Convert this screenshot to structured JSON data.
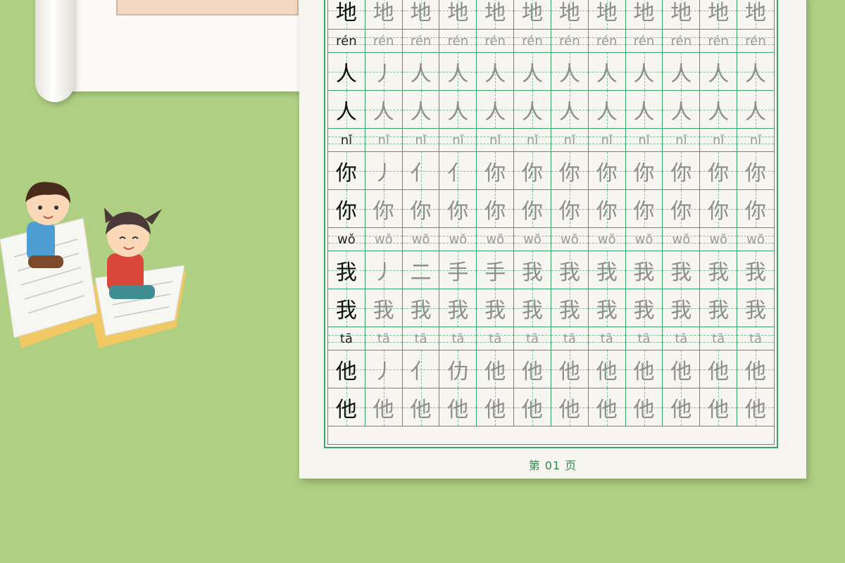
{
  "worksheet": {
    "page_label": "第 01 页",
    "columns": 12,
    "rows": [
      {
        "type": "hanzi",
        "cells": [
          "地",
          "地",
          "地",
          "地",
          "地",
          "地",
          "地",
          "地",
          "地",
          "地",
          "地",
          "地"
        ]
      },
      {
        "type": "pinyin",
        "cells": [
          "rén",
          "rén",
          "rén",
          "rén",
          "rén",
          "rén",
          "rén",
          "rén",
          "rén",
          "rén",
          "rén",
          "rén"
        ]
      },
      {
        "type": "hanzi",
        "cells": [
          "人",
          "丿",
          "人",
          "人",
          "人",
          "人",
          "人",
          "人",
          "人",
          "人",
          "人",
          "人"
        ]
      },
      {
        "type": "hanzi",
        "cells": [
          "人",
          "人",
          "人",
          "人",
          "人",
          "人",
          "人",
          "人",
          "人",
          "人",
          "人",
          "人"
        ]
      },
      {
        "type": "pinyin",
        "cells": [
          "nǐ",
          "nǐ",
          "nǐ",
          "nǐ",
          "nǐ",
          "nǐ",
          "nǐ",
          "nǐ",
          "nǐ",
          "nǐ",
          "nǐ",
          "nǐ"
        ]
      },
      {
        "type": "hanzi",
        "cells": [
          "你",
          "丿",
          "亻",
          "亻",
          "你",
          "你",
          "你",
          "你",
          "你",
          "你",
          "你",
          "你"
        ]
      },
      {
        "type": "hanzi",
        "cells": [
          "你",
          "你",
          "你",
          "你",
          "你",
          "你",
          "你",
          "你",
          "你",
          "你",
          "你",
          "你"
        ]
      },
      {
        "type": "pinyin",
        "cells": [
          "wǒ",
          "wǒ",
          "wǒ",
          "wǒ",
          "wǒ",
          "wǒ",
          "wǒ",
          "wǒ",
          "wǒ",
          "wǒ",
          "wǒ",
          "wǒ"
        ]
      },
      {
        "type": "hanzi",
        "cells": [
          "我",
          "丿",
          "二",
          "手",
          "手",
          "我",
          "我",
          "我",
          "我",
          "我",
          "我",
          "我"
        ]
      },
      {
        "type": "hanzi",
        "cells": [
          "我",
          "我",
          "我",
          "我",
          "我",
          "我",
          "我",
          "我",
          "我",
          "我",
          "我",
          "我"
        ]
      },
      {
        "type": "pinyin",
        "cells": [
          "tā",
          "tā",
          "tā",
          "tā",
          "tā",
          "tā",
          "tā",
          "tā",
          "tā",
          "tā",
          "tā",
          "tā"
        ]
      },
      {
        "type": "hanzi",
        "cells": [
          "他",
          "丿",
          "亻",
          "仂",
          "他",
          "他",
          "他",
          "他",
          "他",
          "他",
          "他",
          "他"
        ]
      },
      {
        "type": "hanzi",
        "cells": [
          "他",
          "他",
          "他",
          "他",
          "他",
          "他",
          "他",
          "他",
          "他",
          "他",
          "他",
          "他"
        ]
      }
    ]
  }
}
